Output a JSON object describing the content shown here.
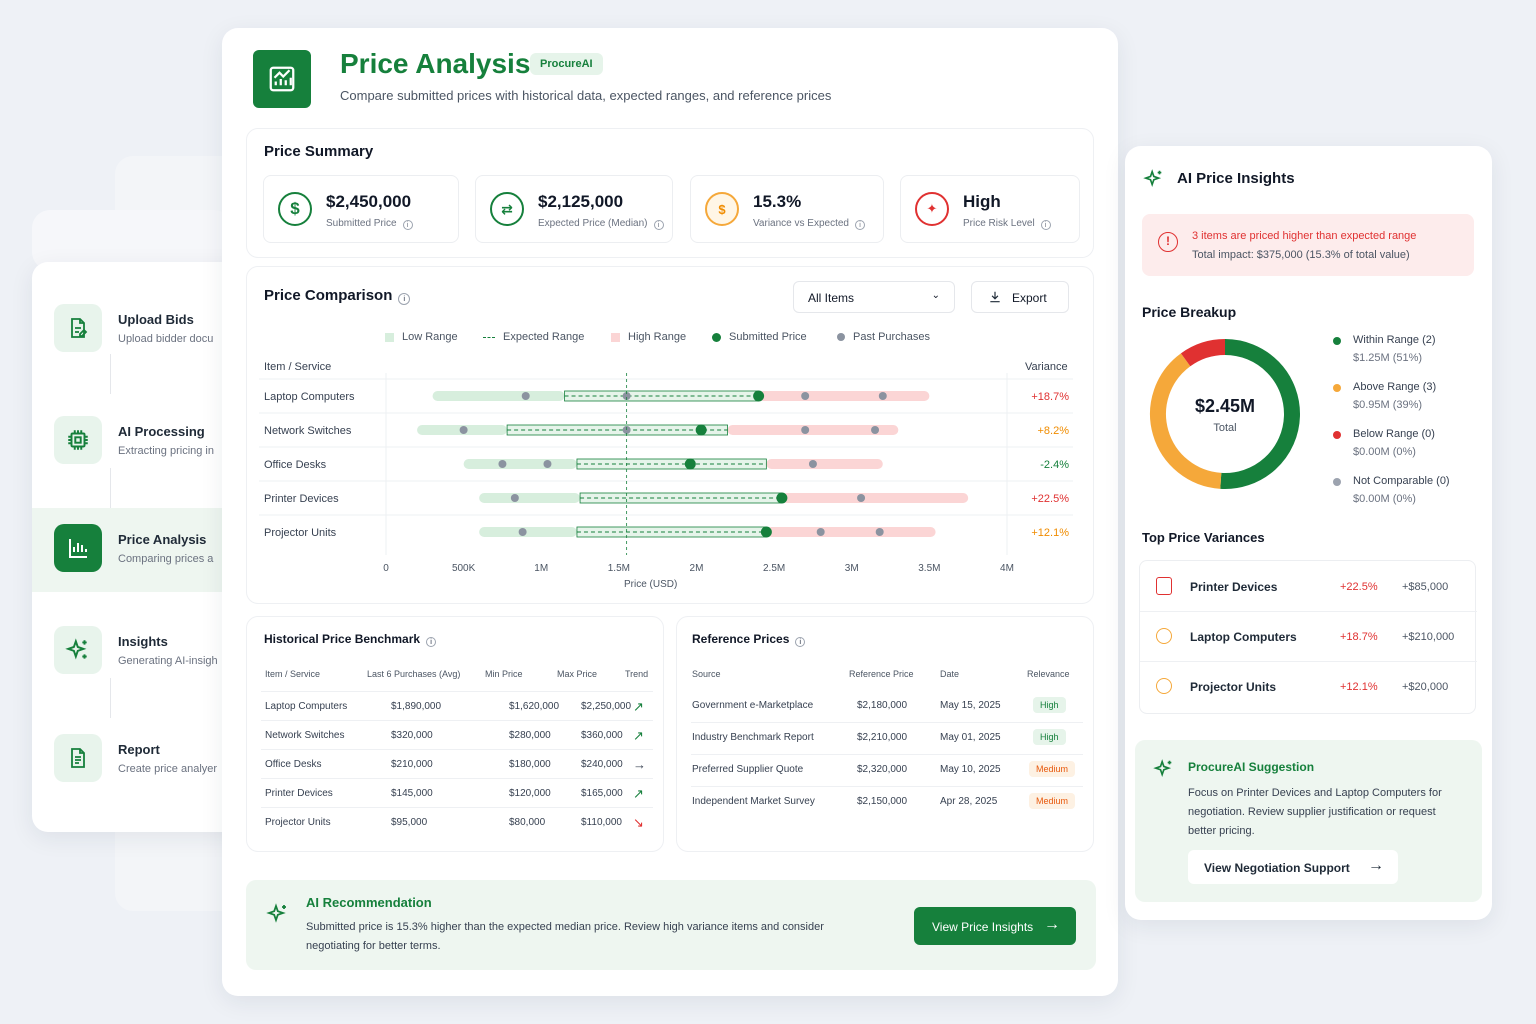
{
  "header": {
    "title": "Price Analysis",
    "badge": "ProcureAI",
    "subtitle": "Compare submitted prices with historical data, expected ranges, and reference prices"
  },
  "steps": [
    {
      "title": "Upload Bids",
      "desc": "Upload bidder docu",
      "icon": "upload-doc-icon"
    },
    {
      "title": "AI Processing",
      "desc": "Extracting pricing in",
      "icon": "chip-icon"
    },
    {
      "title": "Price Analysis",
      "desc": "Comparing prices a",
      "icon": "bar-chart-icon",
      "active": true
    },
    {
      "title": "Insights",
      "desc": "Generating AI-insigh",
      "icon": "sparkle-icon"
    },
    {
      "title": "Report",
      "desc": "Create price analyer",
      "icon": "report-icon"
    }
  ],
  "summary": {
    "title": "Price Summary",
    "kpis": [
      {
        "value": "$2,450,000",
        "label": "Submitted Price",
        "icon": "dollar-icon",
        "color": "#16803c"
      },
      {
        "value": "$2,125,000",
        "label": "Expected Price (Median)",
        "icon": "exchange-icon",
        "color": "#16803c"
      },
      {
        "value": "15.3%",
        "label": "Variance vs Expected",
        "icon": "money-bag-icon",
        "color": "#f59f00"
      },
      {
        "value": "High",
        "label": "Price Risk Level",
        "icon": "alert-sparkle-icon",
        "color": "#e03131"
      }
    ]
  },
  "comparison": {
    "title": "Price Comparison",
    "filter": "All Items",
    "export": "Export",
    "legend": [
      "Low Range",
      "Expected Range",
      "High Range",
      "Submitted Price",
      "Past Purchases"
    ],
    "col_item": "Item / Service",
    "col_variance": "Variance",
    "xlabel": "Price (USD)",
    "ticks": [
      "0",
      "500K",
      "1M",
      "1.5M",
      "2M",
      "2.5M",
      "3M",
      "3.5M",
      "4M"
    ]
  },
  "chart_data": {
    "type": "range",
    "xlabel": "Price (USD)",
    "xlim": [
      0,
      4000000
    ],
    "rows": [
      {
        "item": "Laptop Computers",
        "low": [
          300000,
          1150000
        ],
        "expected": [
          1150000,
          2400000
        ],
        "high": [
          2400000,
          3500000
        ],
        "submitted": 2400000,
        "past": [
          900000,
          1550000,
          2700000,
          3200000
        ],
        "variance": "+18.7%",
        "variance_color": "#e03131"
      },
      {
        "item": "Network Switches",
        "low": [
          200000,
          780000
        ],
        "expected": [
          780000,
          2200000
        ],
        "high": [
          2200000,
          3300000
        ],
        "submitted": 2030000,
        "past": [
          500000,
          1550000,
          2700000,
          3150000
        ],
        "variance": "+8.2%",
        "variance_color": "#f08c00"
      },
      {
        "item": "Office Desks",
        "low": [
          500000,
          1230000
        ],
        "expected": [
          1230000,
          2450000
        ],
        "high": [
          2450000,
          3200000
        ],
        "submitted": 1960000,
        "past": [
          750000,
          1040000,
          2750000
        ],
        "variance": "-2.4%",
        "variance_color": "#16803c"
      },
      {
        "item": "Printer Devices",
        "low": [
          600000,
          1250000
        ],
        "expected": [
          1250000,
          2550000
        ],
        "high": [
          2550000,
          3750000
        ],
        "submitted": 2550000,
        "past": [
          830000,
          3060000
        ],
        "variance": "+22.5%",
        "variance_color": "#e03131"
      },
      {
        "item": "Projector Units",
        "low": [
          600000,
          1230000
        ],
        "expected": [
          1230000,
          2450000
        ],
        "high": [
          2450000,
          3540000
        ],
        "submitted": 2450000,
        "past": [
          880000,
          2800000,
          3180000
        ],
        "variance": "+12.1%",
        "variance_color": "#f08c00"
      }
    ]
  },
  "historical": {
    "title": "Historical Price Benchmark",
    "headers": [
      "Item / Service",
      "Last 6 Purchases (Avg)",
      "Min Price",
      "Max Price",
      "Trend"
    ],
    "rows": [
      {
        "item": "Laptop Computers",
        "avg": "$1,890,000",
        "min": "$1,620,000",
        "max": "$2,250,000",
        "trend": "↗",
        "trend_color": "#16803c"
      },
      {
        "item": "Network Switches",
        "avg": "$320,000",
        "min": "$280,000",
        "max": "$360,000",
        "trend": "↗",
        "trend_color": "#16803c"
      },
      {
        "item": "Office Desks",
        "avg": "$210,000",
        "min": "$180,000",
        "max": "$240,000",
        "trend": "→",
        "trend_color": "#374151"
      },
      {
        "item": "Printer Devices",
        "avg": "$145,000",
        "min": "$120,000",
        "max": "$165,000",
        "trend": "↗",
        "trend_color": "#16803c"
      },
      {
        "item": "Projector Units",
        "avg": "$95,000",
        "min": "$80,000",
        "max": "$110,000",
        "trend": "↘",
        "trend_color": "#e03131"
      }
    ]
  },
  "reference": {
    "title": "Reference Prices",
    "headers": [
      "Source",
      "Reference Price",
      "Date",
      "Relevance"
    ],
    "rows": [
      {
        "source": "Government e-Marketplace",
        "price": "$2,180,000",
        "date": "May 15, 2025",
        "relevance": "High"
      },
      {
        "source": "Industry Benchmark Report",
        "price": "$2,210,000",
        "date": "May 01, 2025",
        "relevance": "High"
      },
      {
        "source": "Preferred Supplier Quote",
        "price": "$2,320,000",
        "date": "May 10, 2025",
        "relevance": "Medium"
      },
      {
        "source": "Independent Market Survey",
        "price": "$2,150,000",
        "date": "Apr 28, 2025",
        "relevance": "Medium"
      }
    ]
  },
  "recommendation": {
    "title": "AI Recommendation",
    "text": "Submitted price is 15.3% higher than the expected median price. Review high variance items and consider negotiating for better terms.",
    "button": "View Price Insights"
  },
  "insights": {
    "title": "AI Price Insights",
    "alert_title": "3 items are priced higher than expected range",
    "alert_text": "Total impact: $375,000 (15.3% of total value)",
    "breakup_title": "Price Breakup",
    "donut_value": "$2.45M",
    "donut_label": "Total",
    "donut": [
      {
        "label": "Within Range (2)",
        "sub": "$1.25M (51%)",
        "share": 0.51,
        "color": "#16803c"
      },
      {
        "label": "Above Range (3)",
        "sub": "$0.95M (39%)",
        "share": 0.39,
        "color": "#f5a83a"
      },
      {
        "label": "Below Range (0)",
        "sub": "$0.00M (0%)",
        "share": 0.1,
        "color": "#e03131"
      },
      {
        "label": "Not Comparable (0)",
        "sub": "$0.00M (0%)",
        "share": 0,
        "color": "#9ca3af"
      }
    ],
    "variances_title": "Top Price Variances",
    "variances": [
      {
        "item": "Printer Devices",
        "pct": "+22.5%",
        "amount": "+$85,000",
        "icon": "printer-icon"
      },
      {
        "item": "Laptop Computers",
        "pct": "+18.7%",
        "amount": "+$210,000",
        "icon": "laptop-icon"
      },
      {
        "item": "Projector Units",
        "pct": "+12.1%",
        "amount": "+$20,000",
        "icon": "projector-icon"
      }
    ],
    "suggestion_title": "ProcureAI Suggestion",
    "suggestion_text": "Focus on Printer Devices and Laptop Computers for negotiation. Review supplier justification or request better pricing.",
    "suggestion_button": "View Negotiation Support"
  }
}
